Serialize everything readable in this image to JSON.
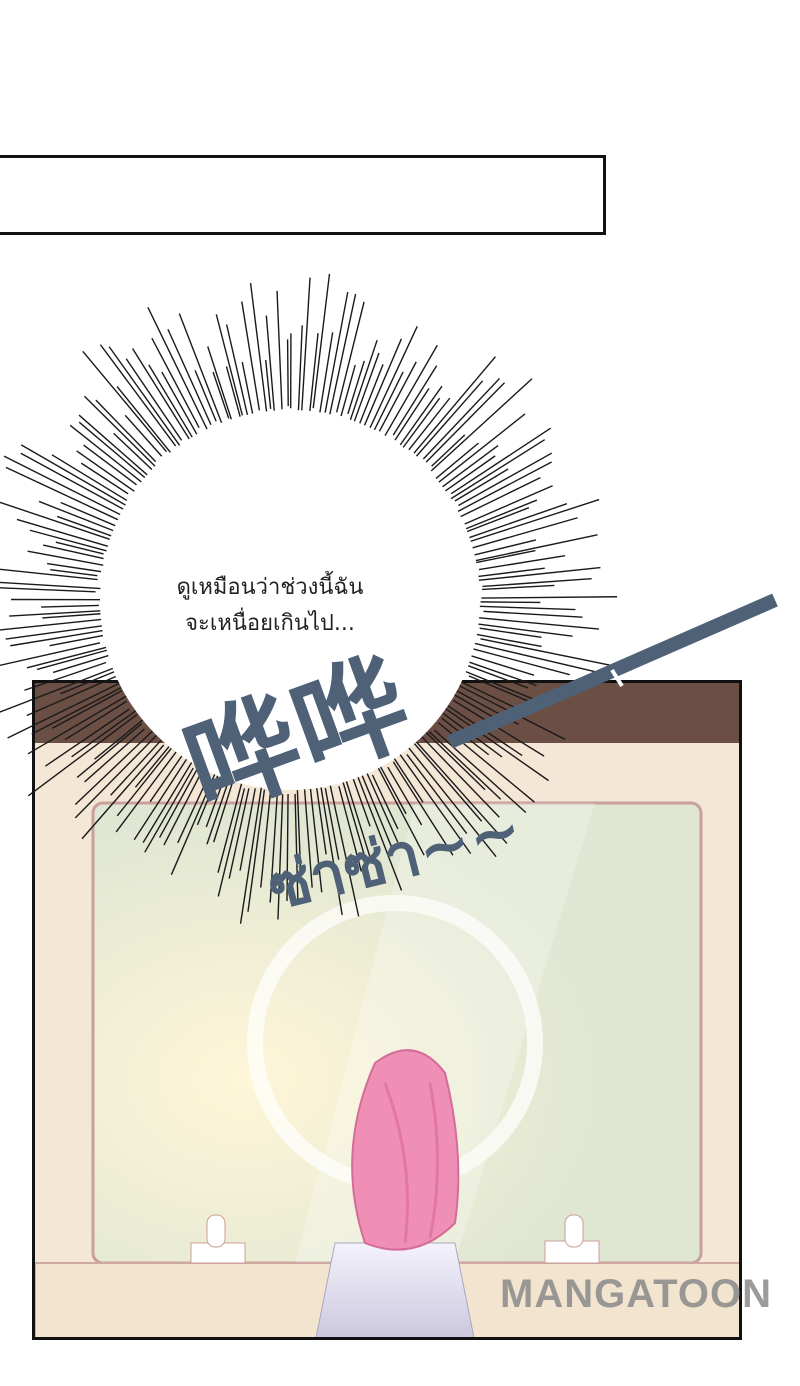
{
  "caption_box": {
    "text": ""
  },
  "thought_bubble": {
    "text": "ดูเหมือนว่าช่วงนี้ฉัน\nจะเหนื่อยเกินไป..."
  },
  "sound_effect": {
    "chinese": "哗哗",
    "thai": "ซ่าซ่า~~"
  },
  "watermark": {
    "text": "MANGATOON"
  },
  "colors": {
    "sfx": "#4e6177",
    "hair": "#f08fb5",
    "mirror": "#e4ead8",
    "counter": "#f3e4d0"
  }
}
